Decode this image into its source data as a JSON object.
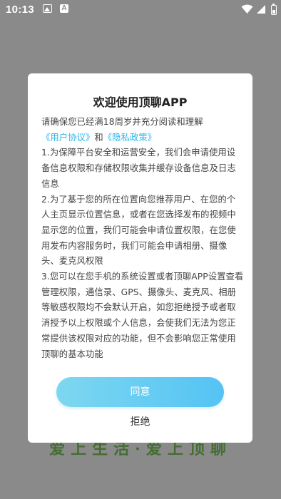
{
  "status_bar": {
    "time": "10:13",
    "icons": [
      "image-icon",
      "a-icon",
      "wifi-icon",
      "cellular-icon",
      "battery-icon"
    ]
  },
  "background": {
    "slogan": "爱上生活·爱上顶聊"
  },
  "dialog": {
    "title": "欢迎使用顶聊APP",
    "intro": "请确保您已经满18周岁并充分阅读和理解",
    "user_agreement_link": "《用户协议》",
    "and_text": "和",
    "privacy_policy_link": "《隐私政策》",
    "clauses": [
      "1.为保障平台安全和运营安全，我们会申请使用设备信息权限和存储权限收集并缓存设备信息及日志信息",
      "2.为了基于您的所在位置向您推荐用户、在您的个人主页显示位置信息，或者在您选择发布的视频中显示您的位置，我们可能会申请位置权限，在您使用发布内容服务时，我们可能会申请相册、摄像头、麦克风权限",
      "3.您可以在您手机的系统设置或者顶聊APP设置查看管理权限，通信录、GPS、摄像头、麦克风、相册等敏感权限均不会默认开启，如您拒绝授予或者取消授予以上权限或个人信息，会使我们无法为您正常提供该权限对应的功能，但不会影响您正常使用顶聊的基本功能"
    ],
    "agree_label": "同意",
    "reject_label": "拒绝"
  },
  "colors": {
    "link": "#29b3ea",
    "agree_button_start": "#7ed7f0",
    "agree_button_end": "#54c3f4",
    "overlay": "#8a8a8a"
  }
}
